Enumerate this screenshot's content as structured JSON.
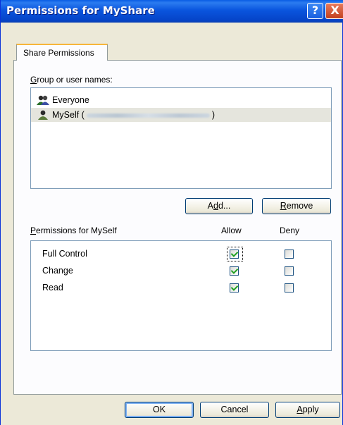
{
  "window": {
    "title": "Permissions for MyShare",
    "help_label": "?",
    "close_label": "X"
  },
  "tabs": [
    {
      "label": "Share Permissions"
    }
  ],
  "groups": {
    "label_hot": "G",
    "label_rest": "roup or user names:",
    "items": [
      {
        "name": "Everyone",
        "suffix": "",
        "selected": false,
        "icon": "users-group-icon"
      },
      {
        "name": "MySelf (",
        "suffix": ")",
        "selected": true,
        "redacted": true,
        "icon": "user-icon"
      }
    ]
  },
  "buttons": {
    "add": {
      "pre": "A",
      "hot": "d",
      "post": "d..."
    },
    "remove": {
      "pre": "",
      "hot": "R",
      "post": "emove"
    }
  },
  "permissions": {
    "header_hot": "P",
    "header_rest": "ermissions for MySelf",
    "allow_header": "Allow",
    "deny_header": "Deny",
    "rows": [
      {
        "name": "Full Control",
        "allow": true,
        "deny": false
      },
      {
        "name": "Change",
        "allow": true,
        "deny": false
      },
      {
        "name": "Read",
        "allow": true,
        "deny": false
      }
    ]
  },
  "footer": {
    "ok": "OK",
    "cancel": "Cancel",
    "apply": {
      "hot": "A",
      "rest": "pply"
    }
  },
  "colors": {
    "title_bar": "#0a55de",
    "checkmark": "#21a121",
    "selection": "#e5e5dd"
  }
}
